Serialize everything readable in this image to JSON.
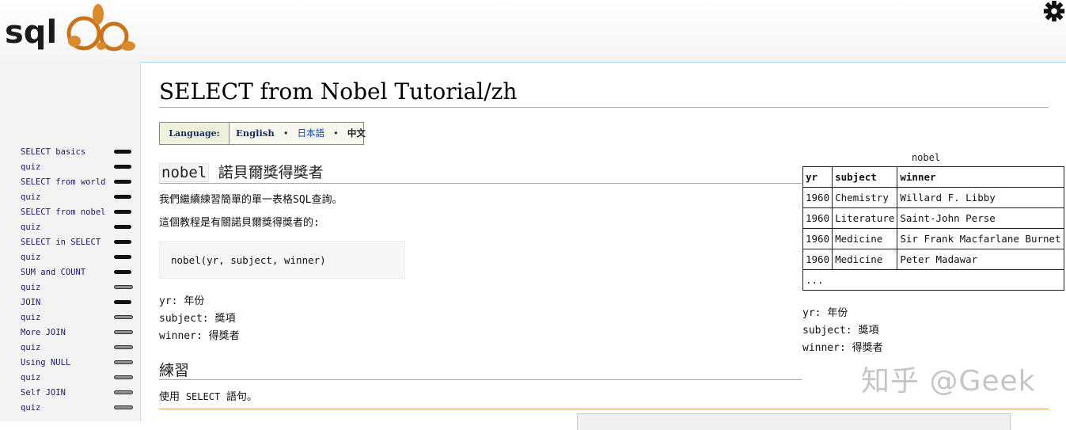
{
  "header": {
    "logo_text": "SQLZOO"
  },
  "sidebar": {
    "items": [
      {
        "label": "SELECT basics",
        "status": "done"
      },
      {
        "label": "quiz",
        "status": "done"
      },
      {
        "label": "SELECT from world",
        "status": "done"
      },
      {
        "label": "quiz",
        "status": "done"
      },
      {
        "label": "SELECT from nobel",
        "status": "done"
      },
      {
        "label": "quiz",
        "status": "done"
      },
      {
        "label": "SELECT in SELECT",
        "status": "done"
      },
      {
        "label": "quiz",
        "status": "done"
      },
      {
        "label": "SUM and COUNT",
        "status": "done"
      },
      {
        "label": "quiz",
        "status": "partial"
      },
      {
        "label": "JOIN",
        "status": "done"
      },
      {
        "label": "quiz",
        "status": "partial"
      },
      {
        "label": "More JOIN",
        "status": "partial"
      },
      {
        "label": "quiz",
        "status": "partial"
      },
      {
        "label": "Using NULL",
        "status": "partial"
      },
      {
        "label": "quiz",
        "status": "partial"
      },
      {
        "label": "Self JOIN",
        "status": "partial"
      },
      {
        "label": "quiz",
        "status": "partial"
      }
    ]
  },
  "main": {
    "title": "SELECT from Nobel Tutorial/zh",
    "language": {
      "label": "Language:",
      "english": "English",
      "sep": "•",
      "japanese": "日本語",
      "chinese": "中文"
    },
    "section1": {
      "code": "nobel",
      "title": "諾貝爾獎得獎者"
    },
    "intro1": "我們繼續練習簡單的單一表格SQL查詢。",
    "intro2": "這個教程是有關諾貝爾獎得獎者的:",
    "code_block": "nobel(yr, subject, winner)",
    "fields": [
      {
        "name": "yr",
        "desc": "年份"
      },
      {
        "name": "subject",
        "desc": "獎項"
      },
      {
        "name": "winner",
        "desc": "得獎者"
      }
    ],
    "section2_title": "練習",
    "use_text_before": "使用 ",
    "use_code": "SELECT",
    "use_text_after": " 語句。"
  },
  "table": {
    "caption": "nobel",
    "headers": [
      "yr",
      "subject",
      "winner"
    ],
    "rows": [
      [
        "1960",
        "Chemistry",
        "Willard F. Libby"
      ],
      [
        "1960",
        "Literature",
        "Saint-John Perse"
      ],
      [
        "1960",
        "Medicine",
        "Sir Frank Macfarlane Burnet"
      ],
      [
        "1960",
        "Medicine",
        "Peter Madawar"
      ]
    ],
    "ellipsis": "...",
    "fields": [
      {
        "name": "yr",
        "desc": "年份"
      },
      {
        "name": "subject",
        "desc": "獎項"
      },
      {
        "name": "winner",
        "desc": "得獎者"
      }
    ]
  },
  "watermark": "知乎 @Geek",
  "colors": {
    "link": "#0645ad",
    "nav_text": "#1a1a6e",
    "rule": "#a2a9b1"
  }
}
